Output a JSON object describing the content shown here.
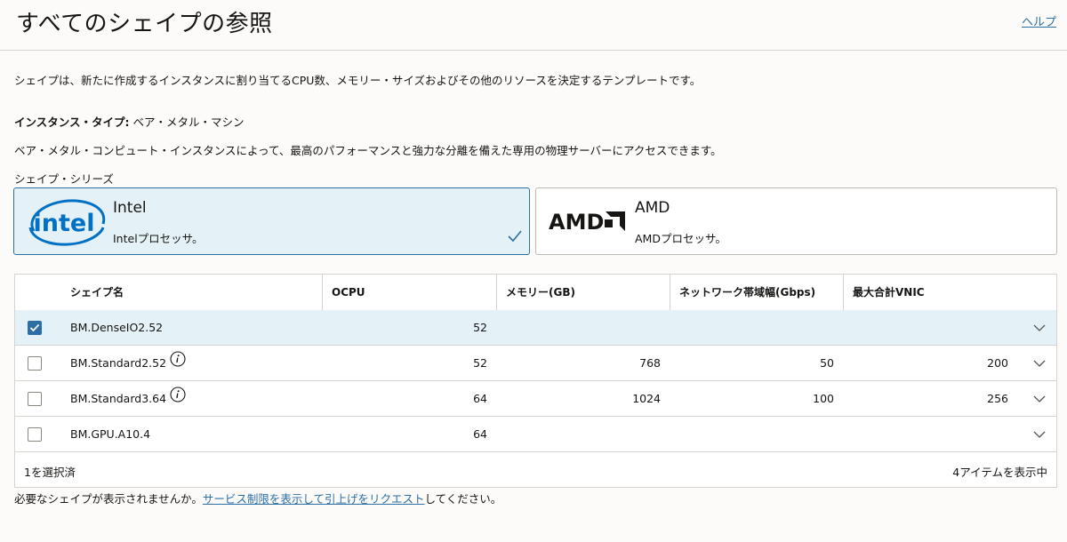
{
  "header": {
    "title": "すべてのシェイプの参照",
    "help_link": "ヘルプ"
  },
  "description": "シェイプは、新たに作成するインスタンスに割り当てるCPU数、メモリー・サイズおよびその他のリソースを決定するテンプレートです。",
  "instance_type": {
    "label": "インスタンス・タイプ:",
    "value": "ベア・メタル・マシン"
  },
  "instance_description": "ベア・メタル・コンピュート・インスタンスによって、最高のパフォーマンスと強力な分離を備えた専用の物理サーバーにアクセスできます。",
  "series": {
    "label": "シェイプ・シリーズ",
    "cards": [
      {
        "name": "Intel",
        "subtitle": "Intelプロセッサ。",
        "logo_text": "intel",
        "selected": true
      },
      {
        "name": "AMD",
        "subtitle": "AMDプロセッサ。",
        "logo_text": "AMD",
        "selected": false
      }
    ]
  },
  "table": {
    "columns": [
      "シェイプ名",
      "OCPU",
      "メモリー(GB)",
      "ネットワーク帯域幅(Gbps)",
      "最大合計VNIC"
    ],
    "rows": [
      {
        "name": "BM.DenseIO2.52",
        "ocpu": "52",
        "memory": "",
        "bandwidth": "",
        "vnic": "",
        "checked": true,
        "info": false
      },
      {
        "name": "BM.Standard2.52",
        "ocpu": "52",
        "memory": "768",
        "bandwidth": "50",
        "vnic": "200",
        "checked": false,
        "info": true
      },
      {
        "name": "BM.Standard3.64",
        "ocpu": "64",
        "memory": "1024",
        "bandwidth": "100",
        "vnic": "256",
        "checked": false,
        "info": true
      },
      {
        "name": "BM.GPU.A10.4",
        "ocpu": "64",
        "memory": "",
        "bandwidth": "",
        "vnic": "",
        "checked": false,
        "info": false
      }
    ],
    "footer_selected": "1を選択済",
    "footer_count": "4アイテムを表示中"
  },
  "bottom_note": {
    "prefix": "必要なシェイプが表示されませんか。",
    "link": "サービス制限を表示して引上げをリクエスト",
    "suffix": "してください。"
  },
  "colors": {
    "accent": "#2c6fa5",
    "selected_bg": "#e4f1f7",
    "border": "#d6d3cf",
    "intel_blue": "#0071c5"
  }
}
